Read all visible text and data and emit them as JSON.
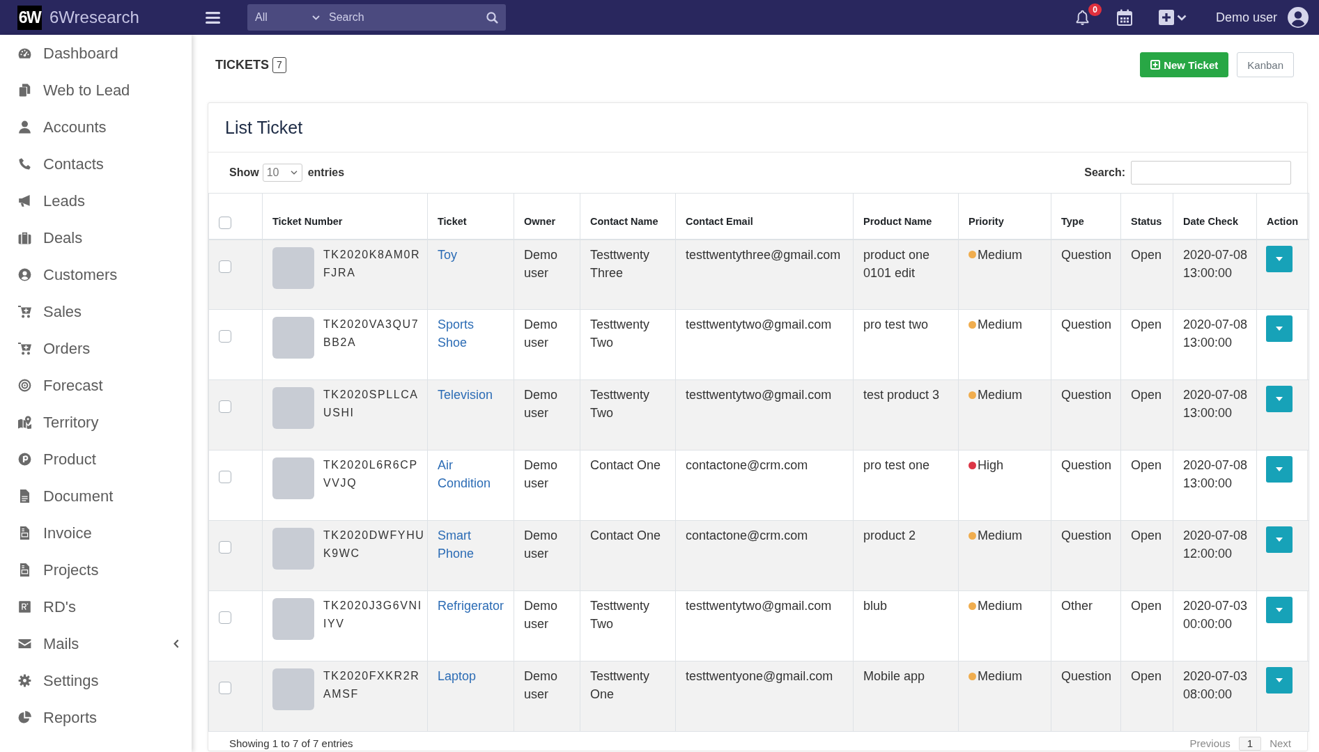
{
  "topbar": {
    "logo": "6W",
    "brand": "6Wresearch",
    "search": {
      "category": "All",
      "placeholder": "Search"
    },
    "notifications": "0",
    "user": "Demo user"
  },
  "sidebar": {
    "items": [
      {
        "label": "Dashboard",
        "kind": "link"
      },
      {
        "label": "Web to Lead",
        "kind": "link"
      },
      {
        "label": "Accounts",
        "kind": "link"
      },
      {
        "label": "Contacts",
        "kind": "link"
      },
      {
        "label": "Leads",
        "kind": "link"
      },
      {
        "label": "Deals",
        "kind": "link"
      },
      {
        "label": "Customers",
        "kind": "link"
      },
      {
        "label": "Sales",
        "kind": "link"
      },
      {
        "label": "Orders",
        "kind": "link"
      },
      {
        "label": "Forecast",
        "kind": "link"
      },
      {
        "label": "Territory",
        "kind": "link"
      },
      {
        "label": "Product",
        "kind": "link"
      },
      {
        "label": "Document",
        "kind": "link"
      },
      {
        "label": "Invoice",
        "kind": "link"
      },
      {
        "label": "Projects",
        "kind": "link"
      },
      {
        "label": "RD's",
        "kind": "link"
      },
      {
        "label": "Mails",
        "kind": "menu"
      },
      {
        "label": "Settings",
        "kind": "link"
      },
      {
        "label": "Reports",
        "kind": "link"
      }
    ]
  },
  "page": {
    "title": "TICKETS",
    "count": "7",
    "buttons": [
      {
        "label": "New Ticket",
        "kind": "primary"
      },
      {
        "label": "Kanban",
        "kind": "secondary"
      }
    ]
  },
  "card": {
    "title": "List Ticket",
    "length_menu": {
      "label_before": "Show",
      "value": "10",
      "label_after": "entries"
    },
    "search_label": "Search:"
  },
  "table": {
    "select_all_checked": false,
    "columns": [
      "Ticket Number",
      "Ticket",
      "Owner",
      "Contact Name",
      "Contact Email",
      "Product Name",
      "Priority",
      "Type",
      "Status",
      "Date Check",
      "Action"
    ],
    "rows": [
      {
        "checked": false,
        "ticket_number": "TK2020K8AM0RFJRA",
        "ticket": "Toy",
        "owner": "Demo user",
        "contact_name": "Testtwenty Three",
        "contact_email": "testtwentythree@gmail.com",
        "product_name": "product one 0101 edit",
        "priority": {
          "label": "Medium",
          "color": "#f0ad4e"
        },
        "type": "Question",
        "status": "Open",
        "date_check": "2020-07-08 13:00:00"
      },
      {
        "checked": false,
        "ticket_number": "TK2020VA3QU7BB2A",
        "ticket": "Sports Shoe",
        "owner": "Demo user",
        "contact_name": "Testtwenty Two",
        "contact_email": "testtwentytwo@gmail.com",
        "product_name": "pro test two",
        "priority": {
          "label": "Medium",
          "color": "#f0ad4e"
        },
        "type": "Question",
        "status": "Open",
        "date_check": "2020-07-08 13:00:00"
      },
      {
        "checked": false,
        "ticket_number": "TK2020SPLLCAUSHI",
        "ticket": "Television",
        "owner": "Demo user",
        "contact_name": "Testtwenty Two",
        "contact_email": "testtwentytwo@gmail.com",
        "product_name": "test product 3",
        "priority": {
          "label": "Medium",
          "color": "#f0ad4e"
        },
        "type": "Question",
        "status": "Open",
        "date_check": "2020-07-08 13:00:00"
      },
      {
        "checked": false,
        "ticket_number": "TK2020L6R6CPVVJQ",
        "ticket": "Air Condition",
        "owner": "Demo user",
        "contact_name": "Contact One",
        "contact_email": "contactone@crm.com",
        "product_name": "pro test one",
        "priority": {
          "label": "High",
          "color": "#dc3545"
        },
        "type": "Question",
        "status": "Open",
        "date_check": "2020-07-08 13:00:00"
      },
      {
        "checked": false,
        "ticket_number": "TK2020DWFYHUK9WC",
        "ticket": "Smart Phone",
        "owner": "Demo user",
        "contact_name": "Contact One",
        "contact_email": "contactone@crm.com",
        "product_name": "product 2",
        "priority": {
          "label": "Medium",
          "color": "#f0ad4e"
        },
        "type": "Question",
        "status": "Open",
        "date_check": "2020-07-08 12:00:00"
      },
      {
        "checked": false,
        "ticket_number": "TK2020J3G6VNIIYV",
        "ticket": "Refrigerator",
        "owner": "Demo user",
        "contact_name": "Testtwenty Two",
        "contact_email": "testtwentytwo@gmail.com",
        "product_name": "blub",
        "priority": {
          "label": "Medium",
          "color": "#f0ad4e"
        },
        "type": "Other",
        "status": "Open",
        "date_check": "2020-07-03 00:00:00"
      },
      {
        "checked": false,
        "ticket_number": "TK2020FXKR2RAMSF",
        "ticket": "Laptop",
        "owner": "Demo user",
        "contact_name": "Testtwenty One",
        "contact_email": "testtwentyone@gmail.com",
        "product_name": "Mobile app",
        "priority": {
          "label": "Medium",
          "color": "#f0ad4e"
        },
        "type": "Question",
        "status": "Open",
        "date_check": "2020-07-03 08:00:00"
      }
    ]
  },
  "footer": {
    "info": "Showing 1 to 7 of 7 entries",
    "pagination": {
      "previous": {
        "label": "Previous",
        "disabled": true
      },
      "pages": [
        {
          "label": "1",
          "selected": true
        }
      ],
      "next": {
        "label": "Next",
        "disabled": true
      }
    }
  }
}
